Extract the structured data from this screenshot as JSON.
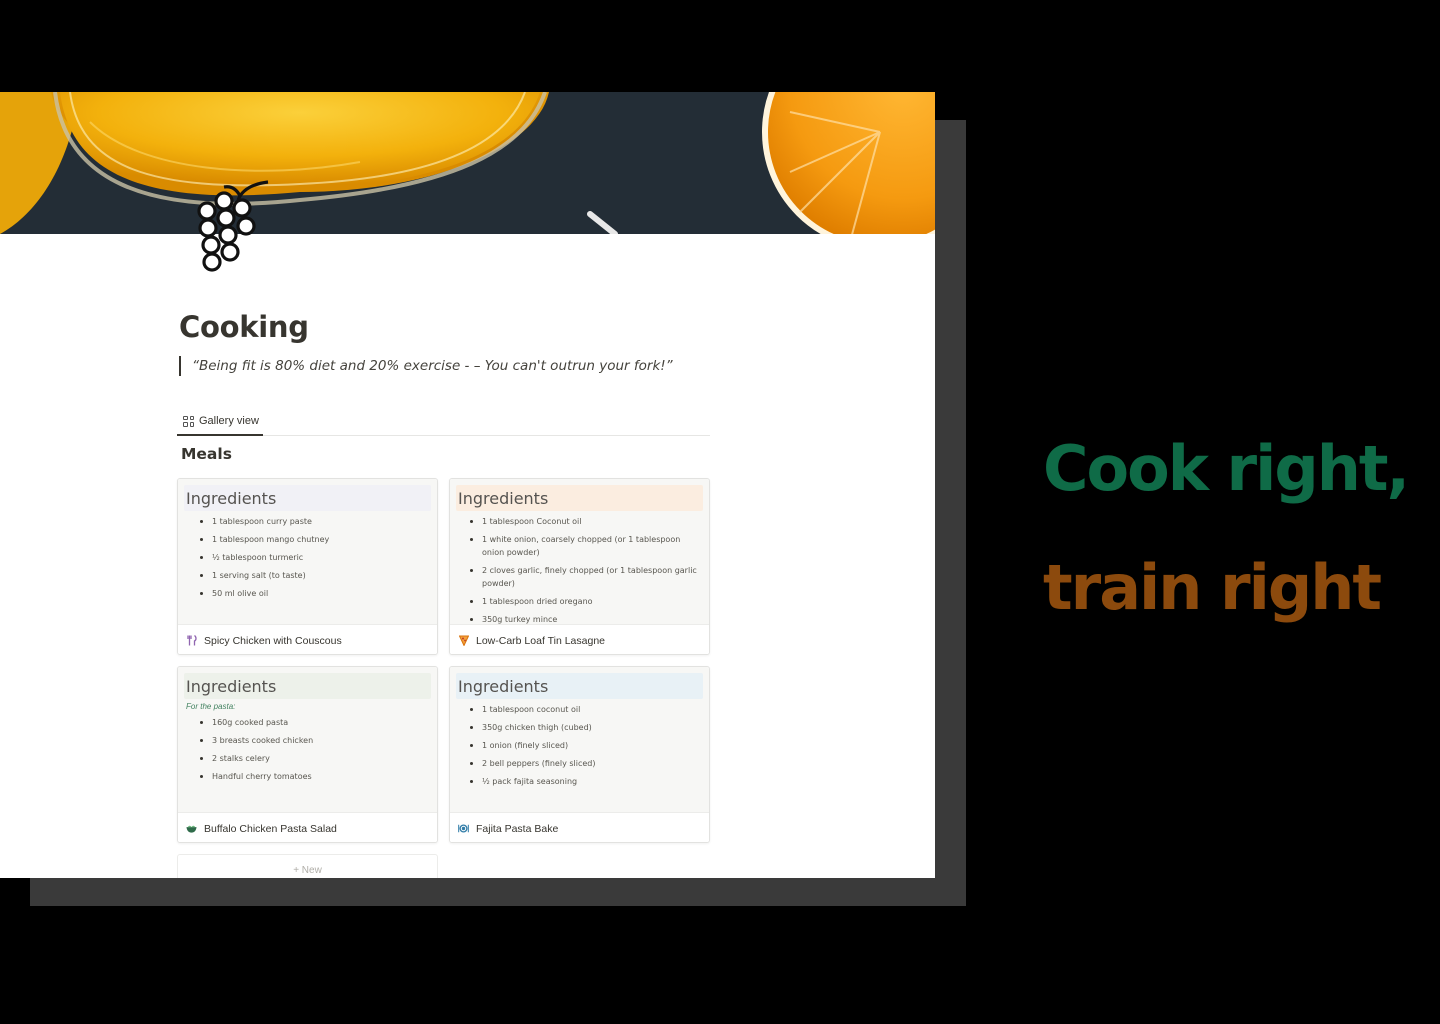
{
  "page": {
    "title": "Cooking",
    "quote": "“Being fit is 80% diet and 20% exercise - – You can't outrun your fork!”",
    "icon": "grapes-icon"
  },
  "tabs": [
    {
      "label": "Gallery view",
      "icon": "gallery-grid-icon"
    }
  ],
  "section": {
    "title": "Meals"
  },
  "cards": [
    {
      "heading": "Ingredients",
      "heading_bg": "#f1f1f6",
      "note": "",
      "items": [
        "1 tablespoon  curry paste",
        "1 tablespoon  mango chutney",
        "½  tablespoon  turmeric",
        "1 serving salt (to taste)",
        "50 ml olive oil"
      ],
      "name": "Spicy Chicken with Couscous",
      "icon": "fork-knife-icon",
      "icon_glyph": "🍴",
      "icon_color": "#9065b0"
    },
    {
      "heading": "Ingredients",
      "heading_bg": "#fbede0",
      "note": "",
      "items": [
        "1 tablespoon Coconut oil",
        "1 white onion, coarsely chopped (or 1 tablespoon onion powder)",
        "2 cloves garlic, finely chopped (or 1 tablespoon garlic powder)",
        "1 tablespoon dried oregano",
        "350g turkey mince"
      ],
      "name": "Low-Carb Loaf Tin Lasagne",
      "icon": "pizza-icon",
      "icon_glyph": "🍕",
      "icon_color": "#d9730d"
    },
    {
      "heading": "Ingredients",
      "heading_bg": "#edf1ea",
      "note": "For the pasta:",
      "items": [
        "160g cooked pasta",
        "3 breasts cooked chicken",
        "2 stalks celery",
        "Handful cherry tomatoes"
      ],
      "name": "Buffalo Chicken Pasta Salad",
      "icon": "bowl-icon",
      "icon_glyph": "🥗",
      "icon_color": "#448361"
    },
    {
      "heading": "Ingredients",
      "heading_bg": "#e8f1f6",
      "note": "",
      "items": [
        "1 tablespoon  coconut oil",
        "350g chicken thigh (cubed)",
        "1 onion (finely sliced)",
        "2 bell peppers (finely sliced)",
        "½ pack fajita seasoning"
      ],
      "name": "Fajita Pasta Bake",
      "icon": "plate-cutlery-icon",
      "icon_glyph": "🍽",
      "icon_color": "#337ea9"
    }
  ],
  "new_button": {
    "label": "+  New"
  },
  "tagline": {
    "line1": "Cook right,",
    "line2": "train right",
    "line1_color": "#0f6b47",
    "line2_color": "#8c4a0d"
  }
}
